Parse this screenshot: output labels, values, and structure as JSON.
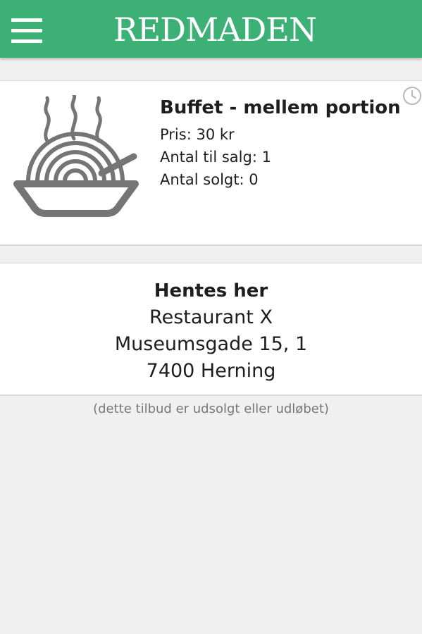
{
  "header": {
    "app_name": "REDMADEN",
    "menu_icon": "hamburger-menu-icon",
    "accent_color": "#3db076"
  },
  "offer": {
    "image_icon": "bowl-of-food-icon",
    "title": "Buffet - mellem portion",
    "price": "Pris: 30 kr",
    "quantity_for_sale": "Antal til salg: 1",
    "quantity_sold": "Antal solgt: 0",
    "status_icon": "clock-icon"
  },
  "pickup": {
    "heading": "Hentes her",
    "restaurant": "Restaurant X",
    "street": "Museumsgade 15, 1",
    "city": "7400 Herning"
  },
  "status_text": "(dette tilbud er udsolgt eller udløbet)"
}
